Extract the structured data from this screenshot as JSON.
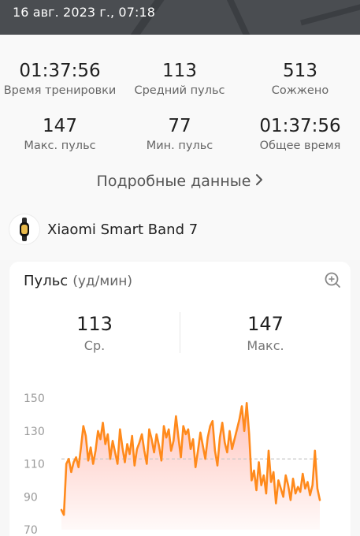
{
  "header": {
    "date": "16 авг. 2023 г., 07:18"
  },
  "summary": {
    "stats": [
      {
        "value": "01:37:56",
        "label": "Время тренировки"
      },
      {
        "value": "113",
        "label": "Средний пульс"
      },
      {
        "value": "513",
        "label": "Сожжено"
      },
      {
        "value": "147",
        "label": "Макс. пульс"
      },
      {
        "value": "77",
        "label": "Мин. пульс"
      },
      {
        "value": "01:37:56",
        "label": "Общее время"
      }
    ],
    "details_link": "Подробные данные"
  },
  "device": {
    "name": "Xiaomi Smart Band 7"
  },
  "pulse_card": {
    "title": "Пульс",
    "unit": "(уд/мин)",
    "avg": {
      "value": "113",
      "label": "Ср."
    },
    "max": {
      "value": "147",
      "label": "Макс."
    }
  },
  "chart_data": {
    "type": "area",
    "ylim": [
      70,
      150
    ],
    "y_ticks": [
      "150",
      "130",
      "110",
      "90",
      "70"
    ],
    "average_line": 113,
    "series": [
      {
        "values": [
          82,
          79,
          110,
          113,
          105,
          111,
          114,
          108,
          120,
          133,
          127,
          112,
          120,
          110,
          118,
          130,
          125,
          135,
          122,
          128,
          113,
          124,
          117,
          110,
          131,
          120,
          111,
          122,
          116,
          127,
          109,
          119,
          123,
          128,
          118,
          110,
          131,
          125,
          117,
          128,
          121,
          112,
          133,
          126,
          131,
          118,
          124,
          139,
          126,
          114,
          133,
          128,
          131,
          119,
          125,
          108,
          118,
          129,
          121,
          113,
          126,
          133,
          136,
          118,
          109,
          126,
          135,
          123,
          117,
          130,
          119,
          125,
          131,
          137,
          145,
          130,
          147,
          128,
          100,
          106,
          94,
          111,
          97,
          103,
          92,
          118,
          99,
          105,
          86,
          100,
          95,
          90,
          103,
          97,
          88,
          101,
          92,
          96,
          93,
          104,
          95,
          99,
          91,
          97,
          118,
          95,
          88
        ]
      }
    ]
  },
  "colors": {
    "accent": "#ff8a1c",
    "fill": "#ff7b6a",
    "header": "#4a4d51"
  },
  "icons": {
    "details": "chevron-right-icon",
    "zoom": "zoom-in-icon",
    "device": "band-icon"
  }
}
